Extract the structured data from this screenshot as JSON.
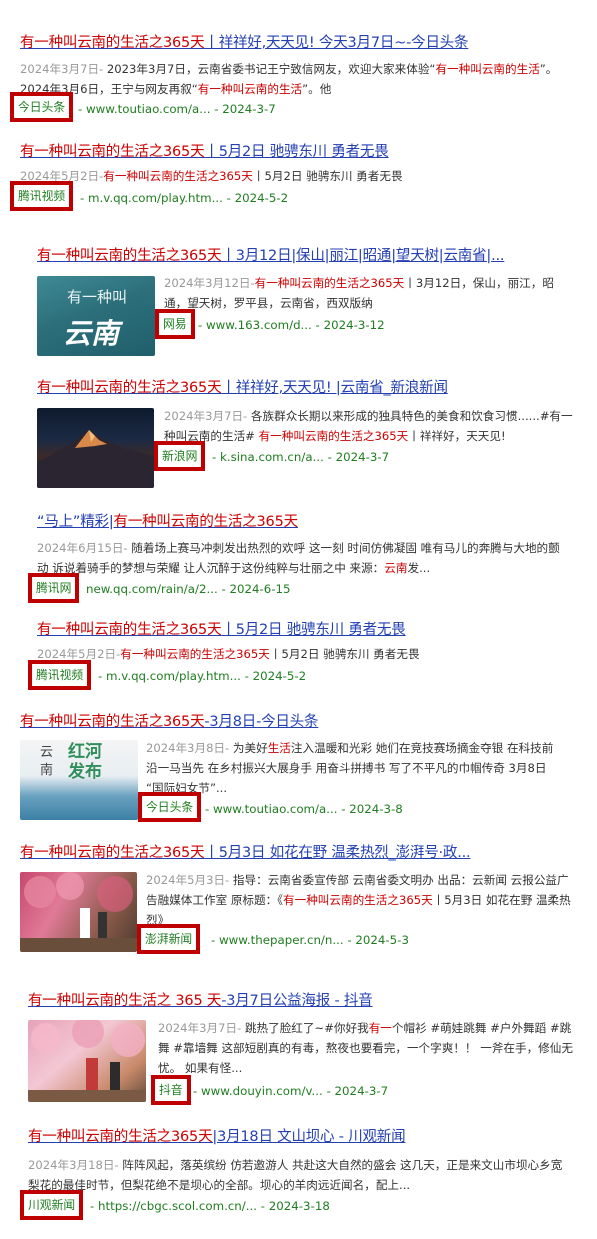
{
  "results": [
    {
      "title_hl": "有一种叫云南的生活之365天",
      "title_rest": "丨祥祥好,天天见!  今天3月7日~-今日头条",
      "date": "2024年3月7日-",
      "desc": " 2023年3月7日，云南省委书记王宁致信网友，欢迎大家来体验“",
      "desc_hl": "有一种叫云南的生活",
      "desc2": "”。2024年3月6日，王宁与网友再叙“",
      "desc2_hl": "有一种叫云南的生活",
      "desc3": "”。他",
      "source": "今日头条",
      "url": "www.toutiao.com/a...",
      "pubdate": "2024-3-7"
    },
    {
      "title_hl": "有一种叫云南的生活之365天",
      "title_rest": "丨5月2日 驰骋东川 勇者无畏",
      "date": "2024年5月2日-",
      "desc_hl": "有一种叫云南的生活之365天",
      "desc": "丨5月2日 驰骋东川 勇者无畏",
      "source": "腾讯视频",
      "url": "m.v.qq.com/play.htm...",
      "pubdate": "2024-5-2"
    },
    {
      "title_hl": "有一种叫云南的生活之365天",
      "title_rest": "丨3月12日|保山|丽江|昭通|望天树|云南省|...",
      "date": "2024年3月12日-",
      "desc_hl": "有一种叫云南的生活之365天",
      "desc": "丨3月12日，保山，丽江，昭通，望天树，罗平县，云南省，西双版纳",
      "source": "网易",
      "url": "www.163.com/d...",
      "pubdate": "2024-3-12",
      "thumb_text1": "有一种叫",
      "thumb_text2": "云南"
    },
    {
      "title_hl": "有一种叫云南的生活之365天",
      "title_rest": "丨祥祥好,天天见! |云南省_新浪新闻",
      "date": "2024年3月7日-",
      "desc": " 各族群众长期以来形成的独具特色的美食和饮食习惯......#有一种叫云南的生活# ",
      "desc_hl": "有一种叫云南的生活之365天",
      "desc2": "丨祥祥好，天天见!",
      "source": "新浪网",
      "url": "k.sina.com.cn/a...",
      "pubdate": "2024-3-7"
    },
    {
      "title_pre": "“马上”精彩|",
      "title_hl": "有一种叫云南的生活之365天",
      "date": "2024年6月15日-",
      "desc": " 随着场上赛马冲刺发出热烈的欢呼 这一刻 时间仿佛凝固 唯有马儿的奔腾与大地的颤动 诉说着骑手的梦想与荣耀 让人沉醉于这份纯粹与壮丽之中 来源：",
      "desc_hl": "云南",
      "desc2": "发...",
      "source": "腾讯网",
      "url": "new.qq.com/rain/a/2...",
      "pubdate": "2024-6-15"
    },
    {
      "title_hl": "有一种叫云南的生活之365天",
      "title_rest": "丨5月2日 驰骋东川 勇者无畏",
      "date": "2024年5月2日-",
      "desc_hl": "有一种叫云南的生活之365天",
      "desc": "丨5月2日 驰骋东川 勇者无畏",
      "source": "腾讯视频",
      "url": "m.v.qq.com/play.htm...",
      "pubdate": "2024-5-2"
    },
    {
      "title_hl": "有一种叫云南的生活之365天",
      "title_rest": "-3月8日-今日头条",
      "date": "2024年3月8日-",
      "desc": " 为美好",
      "desc_hl": "生活",
      "desc2": "注入温暖和光彩 她们在竞技赛场摘金夺银 在科技前沿一马当先 在乡村振兴大展身手 用奋斗拼搏书 写了不平凡的巾帼传奇 3月8日 “国际妇女节”...",
      "source": "今日头条",
      "url": "www.toutiao.com/a...",
      "pubdate": "2024-3-8",
      "thumb_text1": "云南",
      "thumb_text2": "红河发布"
    },
    {
      "title_hl": "有一种叫云南的生活之365天",
      "title_rest": "丨5月3日 如花在野 温柔热烈_澎湃号·政...",
      "date": "2024年5月3日-",
      "desc": " 指导：云南省委宣传部 云南省委文明办 出品：云新闻 云报公益广告融媒体工作室 原标题：《",
      "desc_hl": "有一种叫云南的生活之365天",
      "desc2": "丨5月3日 如花在野 温柔热烈》",
      "source": "澎湃新闻",
      "url": "www.thepaper.cn/n...",
      "pubdate": "2024-5-3"
    },
    {
      "title_hl": "有一种叫云南的生活之 365 天",
      "title_rest": "-3月7日公益海报 - 抖音",
      "date": "2024年3月7日-",
      "desc": " 跳热了脸红了~#你好我",
      "desc_hl": "有一",
      "desc2": "个帽衫 #萌娃跳舞 #户外舞蹈 #跳舞 #靠墙舞 这部短剧真的有毒，熬夜也要看完，一个字爽！！ 一斧在手，修仙无忧。 如果有怪...",
      "source": "抖音",
      "url": "www.douyin.com/v...",
      "pubdate": "2024-3-7"
    },
    {
      "title_hl": "有一种叫云南的生活之365天",
      "title_rest": "|3月18日 文山坝心 - 川观新闻",
      "date": "2024年3月18日-",
      "desc": " 阵阵风起，落英缤纷 仿若邀游人 共赴这大自然的盛会 这几天，正是来文山市坝心乡宽梨花的最佳时节，但梨花绝不是坝心的全部。坝心的羊肉远近闻名，配上...",
      "source": "川观新闻",
      "url": "https://cbgc.scol.com.cn/...",
      "pubdate": "2024-3-18"
    }
  ]
}
